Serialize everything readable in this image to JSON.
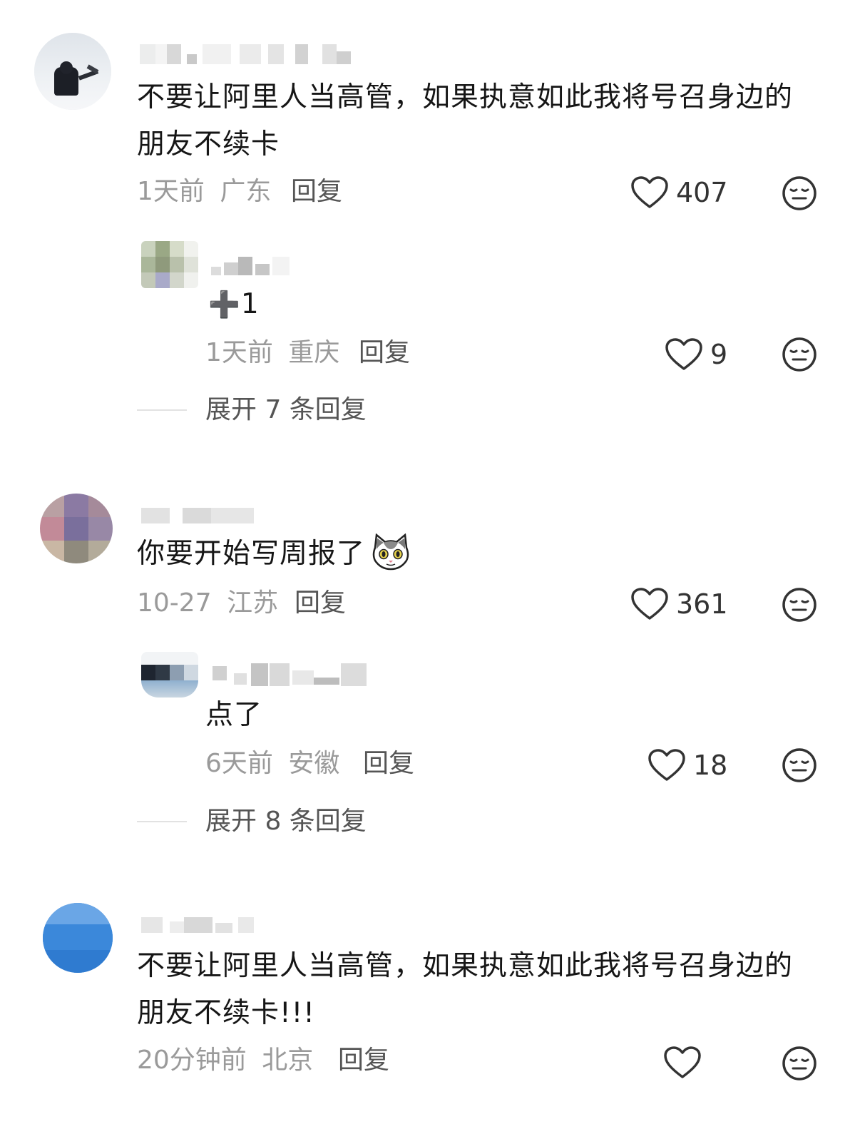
{
  "comments": [
    {
      "text_line1": "不要让阿里人当高管，如果执意如此我将号召身边的",
      "text_line2": "朋友不续卡",
      "time": "1天前",
      "location": "广东",
      "reply_label": "回复",
      "likes": "407",
      "like_icon": "heart-outline-icon",
      "dislike_icon": "meh-face-icon",
      "sub_reply": {
        "text_plus": "➕",
        "text_num": "1",
        "time": "1天前",
        "location": "重庆",
        "reply_label": "回复",
        "likes": "9"
      },
      "expand_label": "展开 7 条回复"
    },
    {
      "text": "你要开始写周报了",
      "sticker": "cat-face-emoji",
      "time": "10-27",
      "location": "江苏",
      "reply_label": "回复",
      "likes": "361",
      "sub_reply": {
        "text": "点了",
        "time": "6天前",
        "location": "安徽",
        "reply_label": "回复",
        "likes": "18"
      },
      "expand_label": "展开 8 条回复"
    },
    {
      "text_line1": "不要让阿里人当高管，如果执意如此我将号召身边的",
      "text_line2": "朋友不续卡!!!",
      "time": "20分钟前",
      "location": "北京",
      "reply_label": "回复",
      "likes": ""
    }
  ],
  "colors": {
    "text": "#161616",
    "meta": "#9a9a9a",
    "reply": "#555555",
    "icon": "#333333"
  }
}
